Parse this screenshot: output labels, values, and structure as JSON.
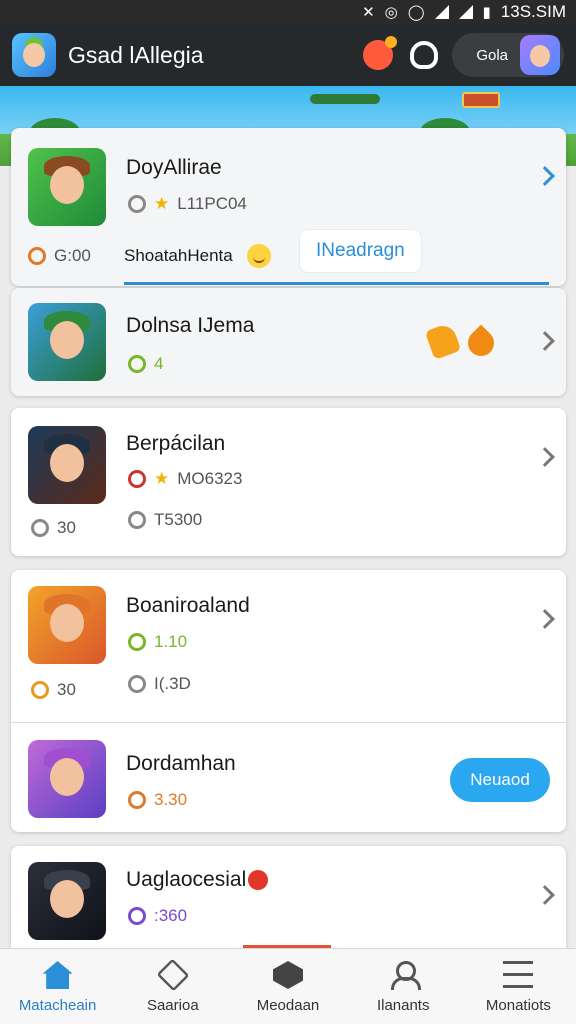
{
  "status_bar": {
    "time": "13S.SIM",
    "icons": [
      "mute-icon",
      "wifi-icon",
      "alarm-icon",
      "signal-icon",
      "battery-icon"
    ]
  },
  "header": {
    "title": "Gsad lAllegia",
    "profile_label": "Gola"
  },
  "games": [
    {
      "title": "DoyAllirae",
      "rating": "L11PC04",
      "size": "G:00",
      "tag": "ShoatahHenta",
      "chip_label": "INeadragn"
    },
    {
      "title": "Dolnsa IJema",
      "count": "4"
    },
    {
      "title": "Berpácilan",
      "rating": "MO6323",
      "size": "30",
      "downloads": "T5300"
    },
    {
      "title": "Boaniroaland",
      "count": "1.10",
      "size": "30",
      "downloads": "I(.3D"
    },
    {
      "title": "Dordamhan",
      "count": "3.30",
      "button_label": "Neuaod"
    },
    {
      "title": "Uaglaocesial",
      "count": ":360"
    }
  ],
  "bottom_nav": [
    "Matacheain",
    "Saarioa",
    "Meodaan",
    "Ilanants",
    "Monatiots"
  ],
  "colors": {
    "accent": "#2a8fd6",
    "header_bg": "#26292b",
    "install_button": "#2aa7ef",
    "nav_indicator": "#e0553a"
  }
}
